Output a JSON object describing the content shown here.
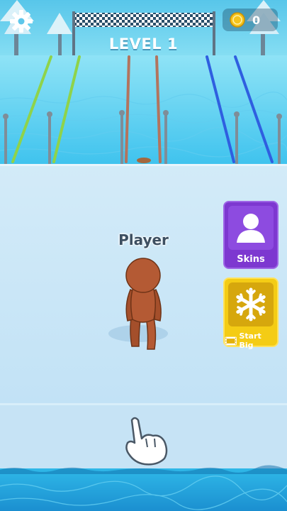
{
  "hud": {
    "level_text": "LEVEL 1",
    "coin_count": "0"
  },
  "player": {
    "name": "Player"
  },
  "side_buttons": {
    "skins_label": "Skins",
    "start_big_label": "Start Big"
  },
  "icons": {
    "settings": "gear-icon",
    "coin": "coin-icon",
    "skins": "person-silhouette-icon",
    "start_big": "snowflake-icon",
    "video": "video-ad-icon",
    "tutorial": "pointing-hand-icon"
  },
  "colors": {
    "sky": "#72d3ee",
    "floor": "#d6ecf9",
    "water": "#27b2e4",
    "skins_button": "#7d38d0",
    "start_big_button": "#f4cc15",
    "player_body": "#b45a34"
  }
}
